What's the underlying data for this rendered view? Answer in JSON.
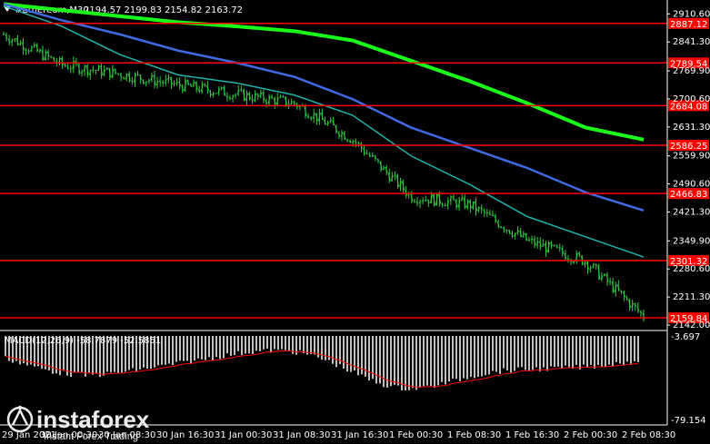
{
  "header": {
    "symbol": "#Ethereum,M30",
    "ohlc": "2194.57 2199.83 2154.82 2163.72",
    "arrow": "triangle-down-icon"
  },
  "price_axis": {
    "ticks": [
      "2910.60",
      "2841.30",
      "2769.90",
      "2700.60",
      "2631.30",
      "2559.90",
      "2490.60",
      "2421.30",
      "2349.90",
      "2280.60",
      "2211.30",
      "2142.00"
    ],
    "range": [
      2142.0,
      2945.0
    ]
  },
  "levels": [
    {
      "label": "2887.12",
      "price": 2887.12
    },
    {
      "label": "2789.54",
      "price": 2789.54
    },
    {
      "label": "2684.08",
      "price": 2684.08
    },
    {
      "label": "2586.25",
      "price": 2586.25
    },
    {
      "label": "2466.83",
      "price": 2466.83
    },
    {
      "label": "2301.32",
      "price": 2301.32
    },
    {
      "label": "2159.84",
      "price": 2159.84
    }
  ],
  "time_axis": {
    "labels": [
      "29 Jan 2021",
      "30 Jan 00:30",
      "30 Jan 08:30",
      "30 Jan 16:30",
      "31 Jan 00:30",
      "31 Jan 08:30",
      "31 Jan 16:30",
      "1 Feb 00:30",
      "1 Feb 08:30",
      "1 Feb 16:30",
      "2 Feb 00:30",
      "2 Feb 08:30"
    ]
  },
  "indicator": {
    "label": "MACD(12,26,9) -58.7879 -52.5851",
    "ticks": [
      "-3.697",
      "-79.154"
    ]
  },
  "watermark": {
    "brand": "instaforex",
    "tagline": "Instant Forex Trading",
    "logo": "instaforex-logo-icon"
  },
  "colors": {
    "background": "#000000",
    "candles": "#2ecc40",
    "level_line": "#ff0000",
    "level_label_bg": "#ff0000",
    "ma_slow": "#1aff1a",
    "ma_mid": "#4169e1",
    "ma_fast": "#20b2aa",
    "macd_hist": "#c0c0c0",
    "macd_signal": "#ff0000"
  },
  "chart_data": {
    "type": "candlestick",
    "title": "#Ethereum,M30",
    "yaxis_range": [
      2142.0,
      2945.0
    ],
    "x": [
      "29 Jan 2021",
      "30 Jan 00:30",
      "30 Jan 08:30",
      "30 Jan 16:30",
      "31 Jan 00:30",
      "31 Jan 08:30",
      "31 Jan 16:30",
      "1 Feb 00:30",
      "1 Feb 08:30",
      "1 Feb 16:30",
      "2 Feb 00:30",
      "2 Feb 08:30"
    ],
    "close": [
      2860,
      2785,
      2762,
      2735,
      2712,
      2690,
      2600,
      2460,
      2440,
      2350,
      2300,
      2163
    ],
    "moving_averages": [
      {
        "name": "",
        "color": "#1aff1a",
        "values": [
          2935,
          2920,
          2905,
          2890,
          2880,
          2868,
          2845,
          2795,
          2745,
          2690,
          2630,
          2600
        ]
      },
      {
        "name": "",
        "color": "#4169e1",
        "values": [
          2935,
          2895,
          2860,
          2820,
          2790,
          2755,
          2700,
          2630,
          2580,
          2530,
          2470,
          2425
        ]
      },
      {
        "name": "",
        "color": "#20b2aa",
        "values": [
          2930,
          2880,
          2810,
          2760,
          2740,
          2710,
          2660,
          2560,
          2490,
          2410,
          2360,
          2310
        ]
      }
    ],
    "horizontal_levels": [
      2887.12,
      2789.54,
      2684.08,
      2586.25,
      2466.83,
      2301.32,
      2159.84
    ],
    "grid": false
  }
}
